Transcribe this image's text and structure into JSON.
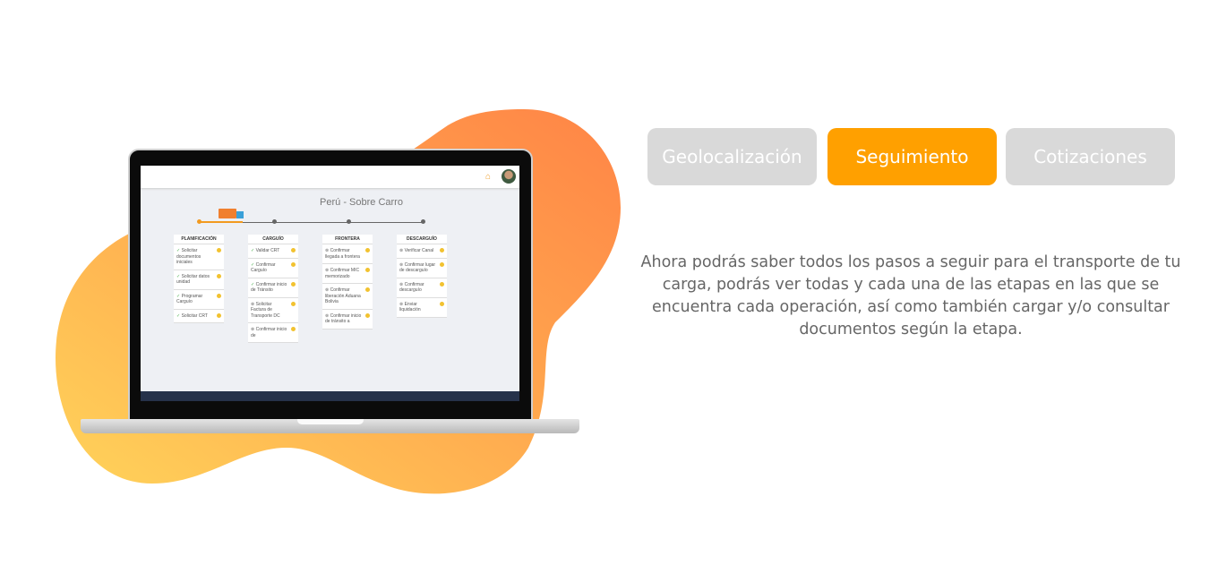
{
  "tabs": [
    {
      "label": "Geolocalización",
      "active": false
    },
    {
      "label": "Seguimiento",
      "active": true
    },
    {
      "label": "Cotizaciones",
      "active": false
    }
  ],
  "description": "Ahora podrás saber todos los pasos a seguir para el transporte de tu carga, podrás ver todas y cada una de las etapas en las que se encuentra cada operación, así como también cargar y/o consultar documentos según la etapa.",
  "colors": {
    "accent": "#ffa000",
    "inactive_tab": "#d9d9d9",
    "blob_start": "#ffd45a",
    "blob_end": "#ff8a4a"
  },
  "screen": {
    "title": "Perú - Sobre Carro",
    "columns": [
      {
        "header": "PLANIFICACIÓN",
        "items": [
          {
            "label": "Solicitar documentos iniciales",
            "done": true
          },
          {
            "label": "Solicitar datos unidad",
            "done": true
          },
          {
            "label": "Programar Carguío",
            "done": true
          },
          {
            "label": "Solicitar CRT",
            "done": true
          }
        ]
      },
      {
        "header": "CARGUÍO",
        "items": [
          {
            "label": "Validar CRT",
            "done": true
          },
          {
            "label": "Confirmar Carguío",
            "done": true
          },
          {
            "label": "Confirmar inicio de Tránsito",
            "done": true
          },
          {
            "label": "Solicitar Factura de Transporte DC",
            "done": false
          },
          {
            "label": "Confirmar inicio de",
            "done": false
          }
        ]
      },
      {
        "header": "FRONTERA",
        "items": [
          {
            "label": "Confirmar llegada a frontera",
            "done": false
          },
          {
            "label": "Confirmar MIC memorizado",
            "done": false
          },
          {
            "label": "Confirmar liberación Aduana Bolivia",
            "done": false
          },
          {
            "label": "Confirmar inicio de tránsito a",
            "done": false
          }
        ]
      },
      {
        "header": "DESCARGUÍO",
        "items": [
          {
            "label": "Verificar Canal",
            "done": false
          },
          {
            "label": "Confirmar lugar de descarguío",
            "done": false
          },
          {
            "label": "Confirmar descarguío",
            "done": false
          },
          {
            "label": "Enviar liquidación",
            "done": false
          }
        ]
      }
    ]
  }
}
